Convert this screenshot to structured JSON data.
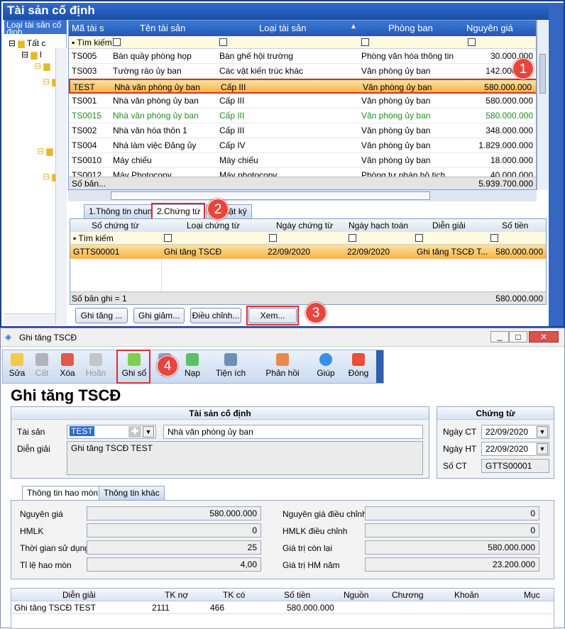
{
  "asset_window": {
    "title": "Tài sản cố định",
    "tree": {
      "header": "Loại tài sản cố định",
      "root": "Tất c",
      "child": "l"
    },
    "columns": [
      "Mã tài s",
      "Tên tài sản",
      "Loại tài sản",
      "Phòng ban",
      "Nguyên giá"
    ],
    "search_label": "Tìm kiếm",
    "rows": [
      {
        "code": "TS005",
        "name": "Bàn quầy phòng họp",
        "type": "Bàn ghế hội trường",
        "dept": "Phòng văn hóa thông tin",
        "cost": "30.000.000"
      },
      {
        "code": "TS003",
        "name": "Tường rào ủy ban",
        "type": "Các vật kiến trúc khác",
        "dept": "Văn phòng ủy ban",
        "cost": "142.000.000"
      },
      {
        "code": "TEST",
        "name": "Nhà văn phòng ủy ban",
        "type": "Cấp III",
        "dept": "Văn phòng ủy ban",
        "cost": "580.000.000"
      },
      {
        "code": "TS001",
        "name": "Nhà văn phòng ủy ban",
        "type": "Cấp III",
        "dept": "Văn phòng ủy ban",
        "cost": "580.000.000"
      },
      {
        "code": "TS0015",
        "name": "Nhà văn phòng ủy ban",
        "type": "Cấp III",
        "dept": "Văn phòng ủy ban",
        "cost": "580.000.000"
      },
      {
        "code": "TS002",
        "name": "Nhà văn hóa thôn 1",
        "type": "Cấp III",
        "dept": "Văn phòng ủy ban",
        "cost": "348.000.000"
      },
      {
        "code": "TS004",
        "name": "Nhà làm việc Đảng ủy",
        "type": "Cấp IV",
        "dept": "Văn phòng ủy ban",
        "cost": "1.829.000.000"
      },
      {
        "code": "TS0010",
        "name": "Máy chiếu",
        "type": "Máy chiếu",
        "dept": "Văn phòng ủy ban",
        "cost": "18.000.000"
      },
      {
        "code": "TS0012",
        "name": "Máy Photocopy",
        "type": "Máy photocopy",
        "dept": "Phòng tư pháp hộ tịch",
        "cost": "40.000.000"
      }
    ],
    "footer_label": "Số bản...",
    "footer_total": "5.939.700.000",
    "tabs": [
      "1.Thông tin chung",
      "2.Chứng từ",
      "3.Nhật ký"
    ],
    "voucher_columns": [
      "Số chứng từ",
      "Loại chứng từ",
      "Ngày chứng từ",
      "Ngày hạch toán",
      "Diễn giải",
      "Số tiền"
    ],
    "voucher_rows": [
      {
        "no": "GTTS00001",
        "type": "Ghi tăng TSCĐ",
        "date": "22/09/2020",
        "post": "22/09/2020",
        "desc": "Ghi tăng TSCĐ T...",
        "amount": "580.000.000"
      }
    ],
    "voucher_footer": "Số bản ghi = 1",
    "voucher_total": "580.000.000",
    "buttons": [
      "Ghi tăng ...",
      "Ghi giảm...",
      "Điều chỉnh...",
      "Xem..."
    ],
    "badges": [
      "1",
      "2",
      "3",
      "4"
    ]
  },
  "form": {
    "window_title": "Ghi tăng TSCĐ",
    "toolbar": [
      "Sửa",
      "Cất",
      "Xóa",
      "Hoãn",
      "Ghi sổ",
      "In",
      "Nạp",
      "Tiện ích",
      "Phản hồi",
      "Giúp",
      "Đóng"
    ],
    "heading": "Ghi tăng TSCĐ",
    "asset_panel": {
      "title": "Tài sản cố định",
      "asset_label": "Tài sản",
      "asset_code": "TEST",
      "asset_name": "Nhà văn phòng ủy ban",
      "desc_label": "Diễn giải",
      "desc_value": "Ghi tăng TSCĐ TEST"
    },
    "voucher_panel": {
      "title": "Chứng từ",
      "ct_date_label": "Ngày CT",
      "ct_date": "22/09/2020",
      "ht_date_label": "Ngày HT",
      "ht_date": "22/09/2020",
      "no_label": "Số CT",
      "no": "GTTS00001"
    },
    "tabs": [
      "Thông tin hao mòn",
      "Thông tin khác"
    ],
    "fields_left": [
      {
        "label": "Nguyên giá",
        "value": "580.000.000"
      },
      {
        "label": "HMLK",
        "value": "0"
      },
      {
        "label": "Thời gian sử dụng",
        "value": "25"
      },
      {
        "label": "Tỉ lệ hao mòn",
        "value": "4,00"
      }
    ],
    "fields_right": [
      {
        "label": "Nguyên giá điều chỉnh",
        "value": "0"
      },
      {
        "label": "HMLK điều chỉnh",
        "value": "0"
      },
      {
        "label": "Giá trị còn lại",
        "value": "580.000.000"
      },
      {
        "label": "Giá trị HM năm",
        "value": "23.200.000"
      }
    ],
    "entry_columns": [
      "Diễn giải",
      "TK nợ",
      "TK có",
      "Số tiền",
      "Nguồn",
      "Chương",
      "Khoản",
      "Mục"
    ],
    "entry_rows": [
      {
        "desc": "Ghi tăng TSCĐ TEST",
        "debit": "2111",
        "credit": "466",
        "amount": "580.000.000"
      }
    ]
  }
}
